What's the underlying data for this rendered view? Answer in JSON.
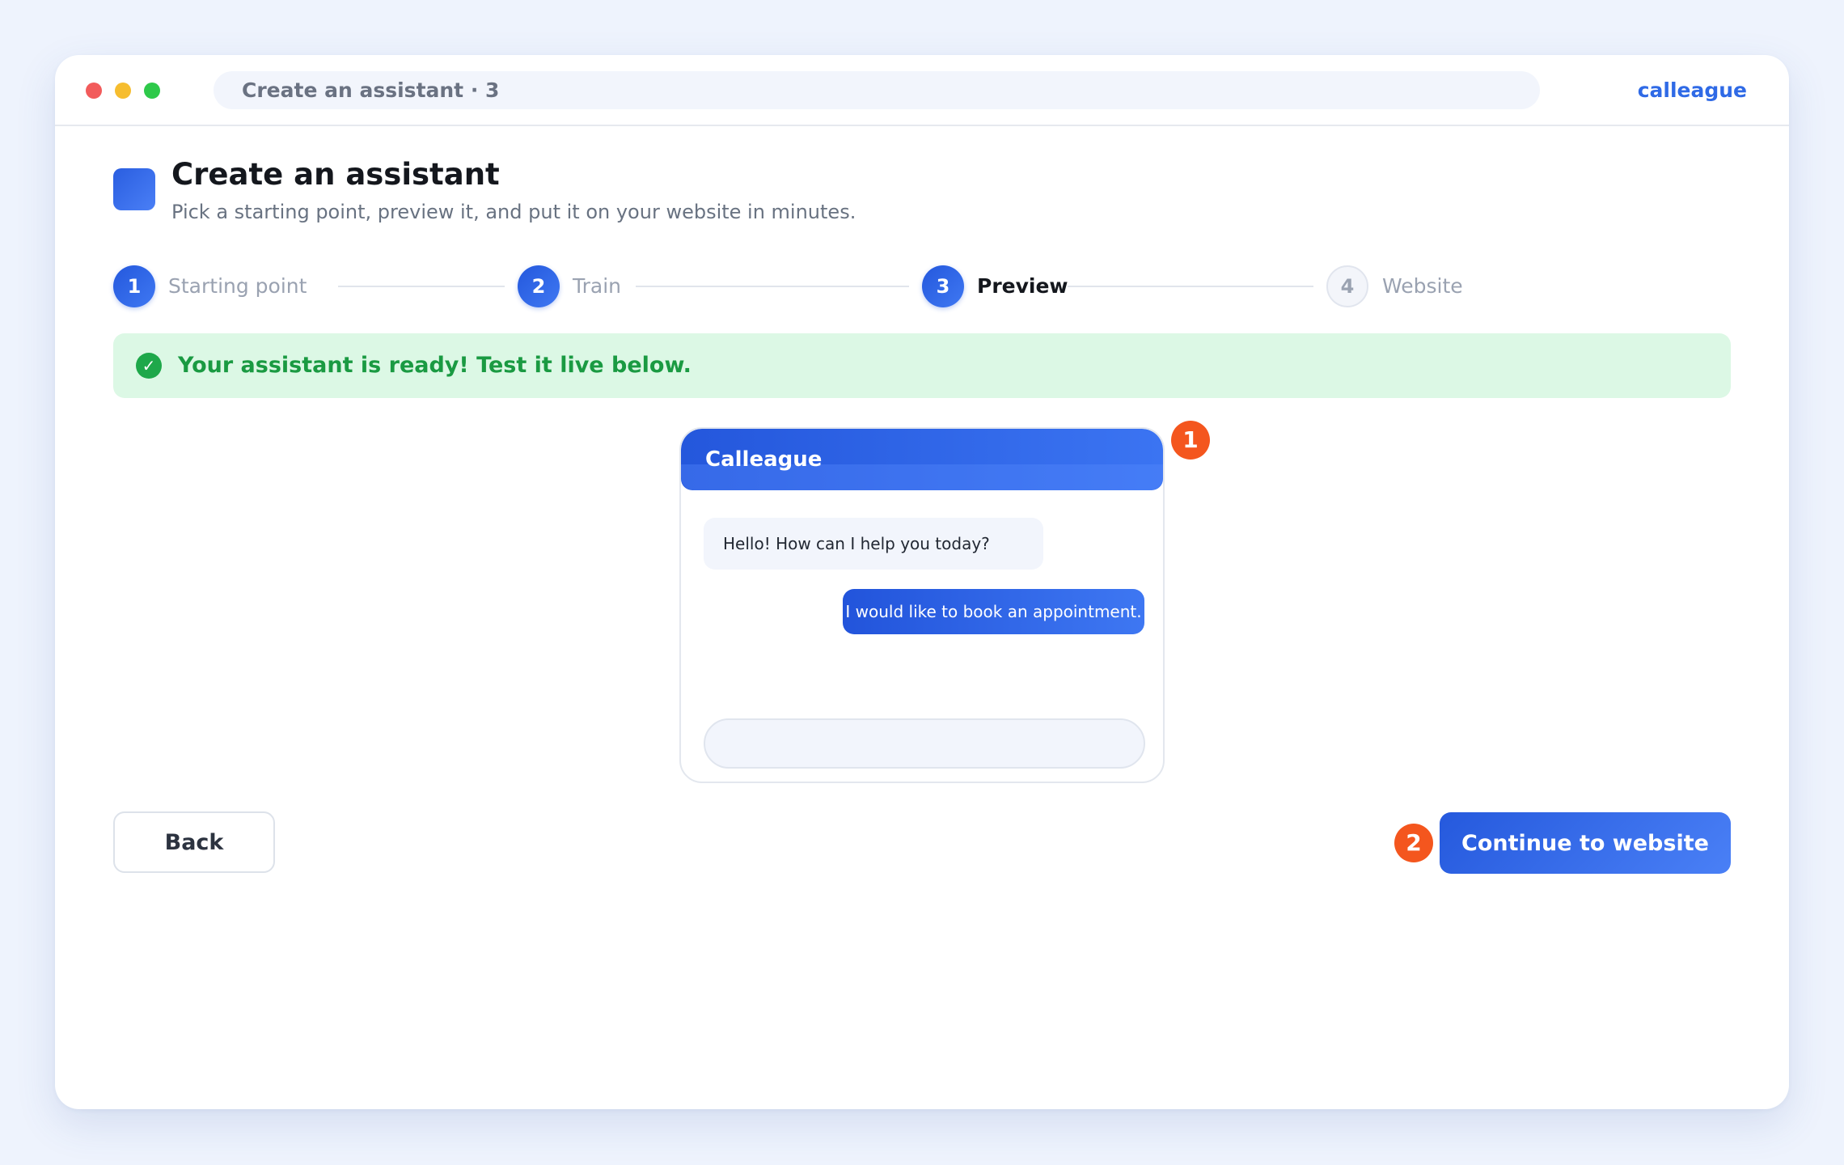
{
  "window": {
    "address_text": "Create an assistant · 3",
    "brand": "calleague"
  },
  "header": {
    "title": "Create an assistant",
    "subtitle": "Pick a starting point, preview it, and put it on your website in minutes."
  },
  "steps": [
    {
      "number": "1",
      "label": "Starting point",
      "state": "completed"
    },
    {
      "number": "2",
      "label": "Train",
      "state": "completed"
    },
    {
      "number": "3",
      "label": "Preview",
      "state": "current"
    },
    {
      "number": "4",
      "label": "Website",
      "state": "pending"
    }
  ],
  "banner": {
    "icon": "check-icon",
    "message": "Your assistant is ready! Test it live below.",
    "color": "#1a9a42"
  },
  "chat": {
    "name": "Calleague",
    "messages": [
      {
        "from": "assistant",
        "text": "Hello! How can I help you today?"
      },
      {
        "from": "user",
        "text": "I would like to book an appointment."
      }
    ],
    "input_value": "",
    "input_placeholder": ""
  },
  "markers": {
    "chat_marker": "1",
    "continue_marker": "2"
  },
  "actions": {
    "back_label": "Back",
    "continue_label": "Continue to website"
  },
  "colors": {
    "accent": "#2f6ae6",
    "marker": "#f4561e",
    "success_bg": "#dcf8e5"
  }
}
